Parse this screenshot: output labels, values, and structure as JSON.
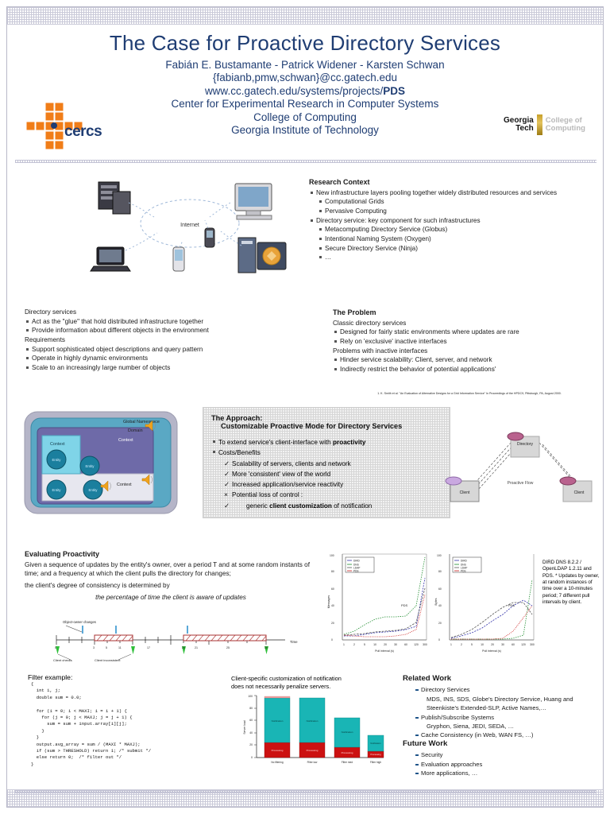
{
  "header": {
    "title": "The Case for Proactive Directory Services",
    "authors": "Fabián E. Bustamante - Patrick Widener - Karsten Schwan",
    "email": "{fabianb,pmw,schwan}@cc.gatech.edu",
    "url_prefix": "www.cc.gatech.edu/systems/projects/",
    "url_bold": "PDS",
    "center": "Center for Experimental Research in Computer Systems",
    "college": "College of Computing",
    "institute": "Georgia Institute of Technology"
  },
  "logos": {
    "cercs_word": "cercs",
    "gt_line1": "Georgia",
    "gt_line2": "Tech",
    "gt_right1": "College of",
    "gt_right2": "Computing"
  },
  "research_context": {
    "heading": "Research Context",
    "items": [
      {
        "level": 1,
        "text": "New infrastructure layers pooling together widely distributed resources and services"
      },
      {
        "level": 2,
        "text": "Computational Grids"
      },
      {
        "level": 2,
        "text": "Pervasive Computing"
      },
      {
        "level": 1,
        "text": "Directory service: key component for such infrastructures"
      },
      {
        "level": 2,
        "text": "Metacomputing Directory Service (Globus)"
      },
      {
        "level": 2,
        "text": "Intentional Naming System (Oxygen)"
      },
      {
        "level": 2,
        "text": "Secure Directory Service (Ninja)"
      },
      {
        "level": 2,
        "text": "…"
      }
    ]
  },
  "top_illustration": {
    "cloud_label": "Internet"
  },
  "directory_services": {
    "heading": "Directory services",
    "items": [
      "Act as the \"glue\" that hold distributed infrastructure together",
      "Provide information about different objects in the environment"
    ],
    "requirements_heading": "Requirements",
    "requirements": [
      "Support sophisticated object descriptions and query pattern",
      "Operate in highly dynamic environments",
      "Scale to an increasingly large number of objects"
    ]
  },
  "the_problem": {
    "heading": "The Problem",
    "sub1": "Classic directory services",
    "items1": [
      "Designed for fairly static environments where updates are rare",
      "Rely on 'exclusive' inactive interfaces"
    ],
    "sub2": "Problems with inactive interfaces",
    "items2": [
      "Hinder service scalability: Client, server, and network",
      "Indirectly restrict the behavior of potential applications'"
    ],
    "citation": "1. K. Smith et al. \"An Evaluation of Alternative Designs for a Grid Information Service\" In Proceedings of the HPDC9, Pittsburgh, PA, August 2000."
  },
  "approach": {
    "title": "The Approach:",
    "title2": "Customizable Proactive Mode for Directory Services",
    "bullet1_pre": "To extend service's client-interface with ",
    "bullet1_bold": "proactivity",
    "bullet2": "Costs/Benefits",
    "checks": [
      "Scalability of servers, clients and network",
      "More 'consistent' view of the world",
      "Increased application/service reactivity"
    ],
    "x_item": "Potential loss of control :",
    "sub_check_pre": "generic ",
    "sub_check_bold": "client customization",
    "sub_check_post": " of notification"
  },
  "nested_diagram": {
    "global": "Global Namespace",
    "domain": "Domain",
    "context_top": "Context",
    "context_left": "Context",
    "context_bottom": "Context",
    "nodes": [
      "Entity",
      "Entity",
      "Entity",
      "Entity"
    ]
  },
  "net_diagram": {
    "top": "Directory",
    "left": "Client",
    "right": "Client",
    "center_label": "Proactive Flow"
  },
  "evaluating": {
    "heading": "Evaluating Proactivity",
    "para1": "Given a sequence of updates by the entity's owner, over a period T and at some random instants of time; and a frequency at which the client pulls the directory for changes;",
    "para2": "the client's degree of consistency is determined by",
    "emph": "the percentage of time the client is aware of updates"
  },
  "timeline": {
    "label_updates": "Object-owner changes",
    "label_axis": "Time",
    "label_client_check": "Client checks",
    "label_inconsistent": "Client inconsistent",
    "ticks": [
      "0",
      "3",
      "5",
      "11",
      "17",
      "20",
      "21",
      "25",
      "30"
    ]
  },
  "sidenote": {
    "text": "DIRD DNS 8.2.2 / OpenLDAP 1.2.11 and PDS. * Updates by owner, at random instances of time over a 10-minutes period; 7 different pull intervals by client."
  },
  "code": {
    "heading": "Filter example:",
    "body": "{\n  int i, j;\n  double sum = 0.0;\n\n  for (i = 0; i < MAXI; i = i + 1) {\n    for (j = 0; j < MAXJ; j = j + 1) {\n      sum = sum + input.array[i][j];\n    }\n  }\n  output.avg_array = sum / (MAXI * MAXJ);\n  if (sum > THRESHOLD) return 1; /* submit */\n  else return 0;  /* filter out */\n}"
  },
  "barchart_caption": {
    "line1": "Client-specific customization of notification",
    "line2": "does not necessarily penalize servers."
  },
  "related_work": {
    "heading": "Related Work",
    "items": [
      {
        "type": "bullet",
        "text": "Directory Services"
      },
      {
        "type": "text",
        "text": "MDS, INS, SDS, Globe's Directory Service, Huang and"
      },
      {
        "type": "text",
        "text": "Steenkiste's Extended-SLP, Active Names,…"
      },
      {
        "type": "bullet",
        "text": "Publish/Subscribe Systems"
      },
      {
        "type": "text",
        "text": "Gryphon, Siena, JEDI, SEDA, …"
      },
      {
        "type": "bullet",
        "text": "Cache Consistency (in Web, WAN FS, …)"
      }
    ]
  },
  "future_work": {
    "heading": "Future Work",
    "items": [
      "Security",
      "Evaluation approaches",
      "More applications, …"
    ]
  },
  "chart_data": [
    {
      "type": "line",
      "title": "PDS",
      "xlabel": "Pull interval (s)",
      "ylabel": "Messages",
      "legend": [
        "DIRD",
        "DNS",
        "LDAP",
        "PDS"
      ],
      "legend_colors": [
        "#3333aa",
        "#1a8a2a",
        "#555555",
        "#cc2222"
      ],
      "x": [
        1,
        2,
        5,
        10,
        20,
        30,
        60,
        120,
        300
      ],
      "xticks": [
        "1",
        "2",
        "5",
        "10",
        "20",
        "30",
        "60",
        "120",
        "300"
      ],
      "ylim": [
        0,
        100
      ],
      "yticks": [
        "0",
        "20",
        "40",
        "60",
        "80",
        "100"
      ],
      "grid": false,
      "legend_position": "top-left",
      "series": [
        {
          "name": "DIRD",
          "values": [
            4,
            5,
            6,
            8,
            9,
            10,
            12,
            16,
            72
          ]
        },
        {
          "name": "DNS",
          "values": [
            6,
            10,
            18,
            24,
            27,
            27,
            28,
            40,
            96
          ]
        },
        {
          "name": "LDAP",
          "values": [
            5,
            6,
            7,
            9,
            10,
            11,
            13,
            20,
            60
          ]
        },
        {
          "name": "PDS",
          "values": [
            5,
            4,
            3,
            3,
            3,
            4,
            6,
            12,
            52
          ]
        }
      ]
    },
    {
      "type": "line",
      "title": "PDS",
      "xlabel": "Pull interval (s)",
      "ylabel": "Bytes",
      "legend": [
        "DIRD",
        "DNS",
        "LDAP",
        "PDS"
      ],
      "legend_colors": [
        "#3333aa",
        "#1a8a2a",
        "#555555",
        "#cc2222"
      ],
      "x": [
        1,
        2,
        5,
        10,
        20,
        30,
        60,
        120,
        300
      ],
      "xticks": [
        "1",
        "2",
        "5",
        "10",
        "20",
        "30",
        "60",
        "120",
        "300"
      ],
      "ylim": [
        0,
        100
      ],
      "yticks": [
        "0",
        "20",
        "40",
        "60",
        "80",
        "100"
      ],
      "grid": false,
      "legend_position": "top-left",
      "series": [
        {
          "name": "DIRD",
          "values": [
            2,
            4,
            8,
            14,
            22,
            30,
            40,
            46,
            40
          ]
        },
        {
          "name": "DNS",
          "values": [
            1,
            1,
            1,
            1,
            1,
            1,
            2,
            6,
            70
          ]
        },
        {
          "name": "LDAP",
          "values": [
            3,
            6,
            12,
            20,
            30,
            38,
            44,
            44,
            30
          ]
        },
        {
          "name": "PDS",
          "values": [
            1,
            1,
            1,
            1,
            1,
            2,
            10,
            26,
            40
          ]
        }
      ]
    },
    {
      "type": "bar",
      "title": "",
      "categories": [
        "No filtering",
        "Filter low",
        "Filter med",
        "Filter high"
      ],
      "ylabel": "Server load",
      "ylim": [
        0,
        100
      ],
      "yticks": [
        "0",
        "20",
        "40",
        "60",
        "80",
        "100"
      ],
      "stacked": true,
      "series": [
        {
          "name": "Notification",
          "color": "#19b5b5",
          "values": [
            72,
            72,
            48,
            26
          ]
        },
        {
          "name": "Processing",
          "color": "#cc1111",
          "values": [
            24,
            24,
            16,
            10
          ]
        }
      ]
    }
  ]
}
